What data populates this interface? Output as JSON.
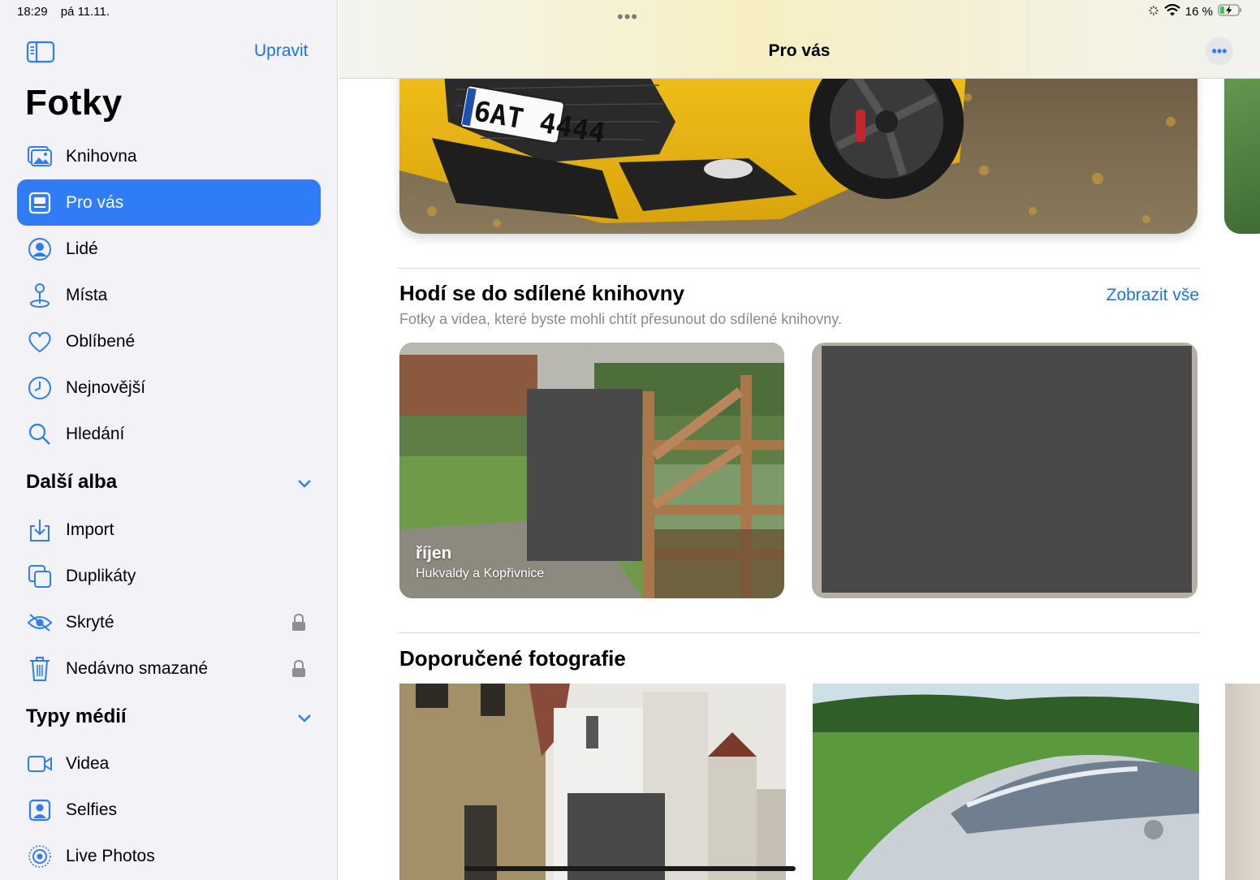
{
  "status": {
    "time": "18:29",
    "date": "pá 11.11.",
    "battery": "16 %"
  },
  "sidebar": {
    "edit_label": "Upravit",
    "title": "Fotky",
    "items": [
      {
        "label": "Knihovna",
        "icon": "photo-library-icon"
      },
      {
        "label": "Pro vás",
        "icon": "for-you-icon",
        "active": true
      },
      {
        "label": "Lidé",
        "icon": "people-icon"
      },
      {
        "label": "Místa",
        "icon": "map-pin-icon"
      },
      {
        "label": "Oblíbené",
        "icon": "heart-icon"
      },
      {
        "label": "Nejnovější",
        "icon": "clock-icon"
      },
      {
        "label": "Hledání",
        "icon": "search-icon"
      }
    ],
    "section_more": "Další alba",
    "more_items": [
      {
        "label": "Import",
        "icon": "import-icon"
      },
      {
        "label": "Duplikáty",
        "icon": "duplicates-icon"
      },
      {
        "label": "Skryté",
        "icon": "hidden-eye-icon",
        "locked": true
      },
      {
        "label": "Nedávno smazané",
        "icon": "trash-icon",
        "locked": true
      }
    ],
    "section_media": "Typy médií",
    "media_items": [
      {
        "label": "Videa",
        "icon": "video-icon"
      },
      {
        "label": "Selfies",
        "icon": "selfie-icon"
      },
      {
        "label": "Live Photos",
        "icon": "live-photo-icon"
      }
    ]
  },
  "main": {
    "title": "Pro vás",
    "shared": {
      "title": "Hodí se do sdílené knihovny",
      "subtitle": "Fotky a videa, které byste mohli chtít přesunout do sdílené knihovny.",
      "show_all": "Zobrazit vše",
      "card1_title": "říjen",
      "card1_subtitle": "Hukvaldy a Kopřivnice"
    },
    "featured": {
      "title": "Doporučené fotografie"
    }
  },
  "colors": {
    "accent": "#2f7cf6",
    "link": "#1a73e8"
  }
}
